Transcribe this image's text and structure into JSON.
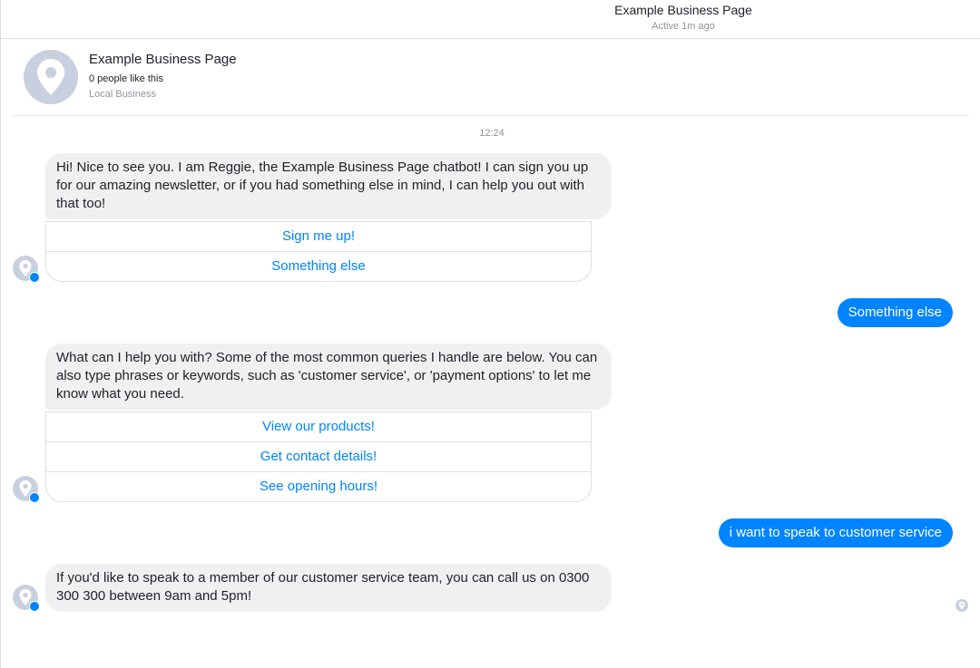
{
  "header": {
    "title": "Example Business Page",
    "status": "Active 1m ago"
  },
  "profile": {
    "avatar_icon": "map-pin-icon",
    "name": "Example Business Page",
    "likes": "0 people like this",
    "category": "Local Business"
  },
  "conversation": {
    "timestamp": "12:24",
    "messages": [
      {
        "sender": "bot",
        "text": "Hi! Nice to see you. I am Reggie, the Example Business Page chatbot! I can sign you up for our amazing newsletter, or if you had something else in mind, I can help you out with that too!",
        "quick_replies": [
          "Sign me up!",
          "Something else"
        ]
      },
      {
        "sender": "user",
        "text": "Something else"
      },
      {
        "sender": "bot",
        "text": "What can I help you with? Some of the most common queries I handle are below. You can also type phrases or keywords, such as 'customer service', or 'payment options' to let me know what you need.",
        "quick_replies": [
          "View our products!",
          "Get contact details!",
          "See opening hours!"
        ]
      },
      {
        "sender": "user",
        "text": "i want to speak to customer service"
      },
      {
        "sender": "bot",
        "text": "If you'd like to speak to a member of our customer service team, you can call us on 0300 300 300 between 9am and 5pm!"
      }
    ]
  },
  "colors": {
    "accent": "#0084ff",
    "incoming_bubble": "#f1f0f0",
    "avatar": "#c8d0e0",
    "muted_text": "#90949c"
  }
}
